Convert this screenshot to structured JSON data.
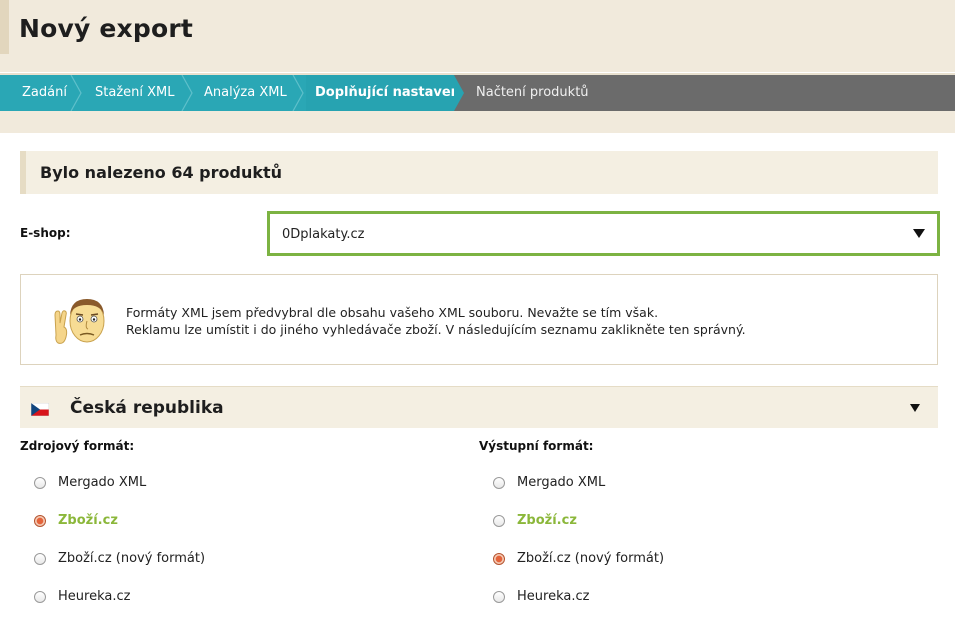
{
  "header": {
    "title": "Nový export"
  },
  "steps": [
    {
      "label": "Zadání",
      "state": "done"
    },
    {
      "label": "Stažení XML",
      "state": "done"
    },
    {
      "label": "Analýza XML",
      "state": "done"
    },
    {
      "label": "Doplňující nastavení",
      "state": "active"
    },
    {
      "label": "Načtení produktů",
      "state": "todo"
    }
  ],
  "found": {
    "text": "Bylo nalezeno 64 produktů"
  },
  "eshop": {
    "label": "E-shop:",
    "selected": "0Dplakaty.cz"
  },
  "info": {
    "line1": "Formáty XML jsem předvybral dle obsahu vašeho XML souboru. Nevažte se tím však.",
    "line2": "Reklamu lze umístit i do jiného vyhledávače zboží. V následujícím seznamu zaklikněte ten správný."
  },
  "country": {
    "name": "Česká republika",
    "flag_icon": "czech-flag-icon"
  },
  "source": {
    "heading": "Zdrojový formát:",
    "options": [
      {
        "label": "Mergado XML",
        "checked": false,
        "highlight": false
      },
      {
        "label": "Zboží.cz",
        "checked": true,
        "highlight": true
      },
      {
        "label": "Zboží.cz (nový formát)",
        "checked": false,
        "highlight": false
      },
      {
        "label": "Heureka.cz",
        "checked": false,
        "highlight": false
      }
    ]
  },
  "output": {
    "heading": "Výstupní formát:",
    "options": [
      {
        "label": "Mergado XML",
        "checked": false,
        "highlight": false
      },
      {
        "label": "Zboží.cz",
        "checked": false,
        "highlight": true
      },
      {
        "label": "Zboží.cz (nový formát)",
        "checked": true,
        "highlight": false
      },
      {
        "label": "Heureka.cz",
        "checked": false,
        "highlight": false
      }
    ]
  },
  "colors": {
    "accent_teal": "#2aa7b5",
    "select_border": "#7cb342",
    "highlight_green": "#8bb73a",
    "radio_checked": "#e4633a"
  }
}
